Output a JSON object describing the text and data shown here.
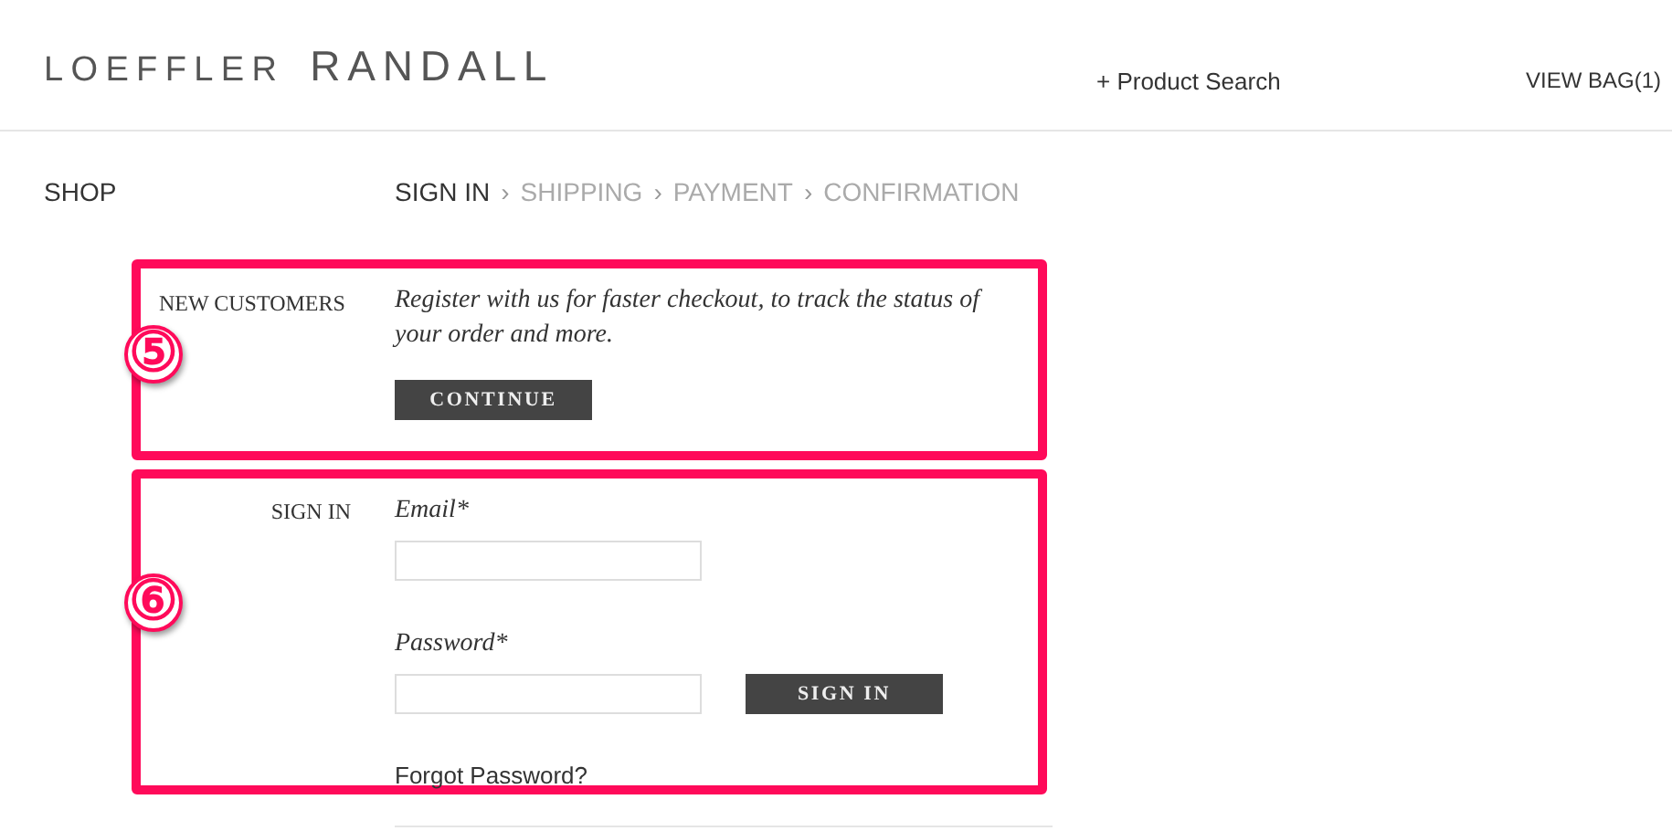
{
  "header": {
    "logo": [
      "LOEFFLER",
      "RANDALL"
    ],
    "product_search": "+ Product Search",
    "view_bag": "VIEW BAG(1)"
  },
  "nav": {
    "shop": "SHOP",
    "separator": "›",
    "steps": [
      {
        "label": "SIGN IN",
        "selected": true
      },
      {
        "label": "SHIPPING",
        "selected": false
      },
      {
        "label": "PAYMENT",
        "selected": false
      },
      {
        "label": "CONFIRMATION",
        "selected": false
      }
    ]
  },
  "new_customers": {
    "marker": "⑤",
    "label": "NEW CUSTOMERS",
    "text": "Register with us for faster checkout, to track the status of your order and more.",
    "button": "CONTINUE"
  },
  "sign_in": {
    "marker": "⑥",
    "label": "SIGN IN",
    "email_label": "Email*",
    "password_label": "Password*",
    "button": "SIGN IN",
    "forgot": "Forgot Password?"
  }
}
